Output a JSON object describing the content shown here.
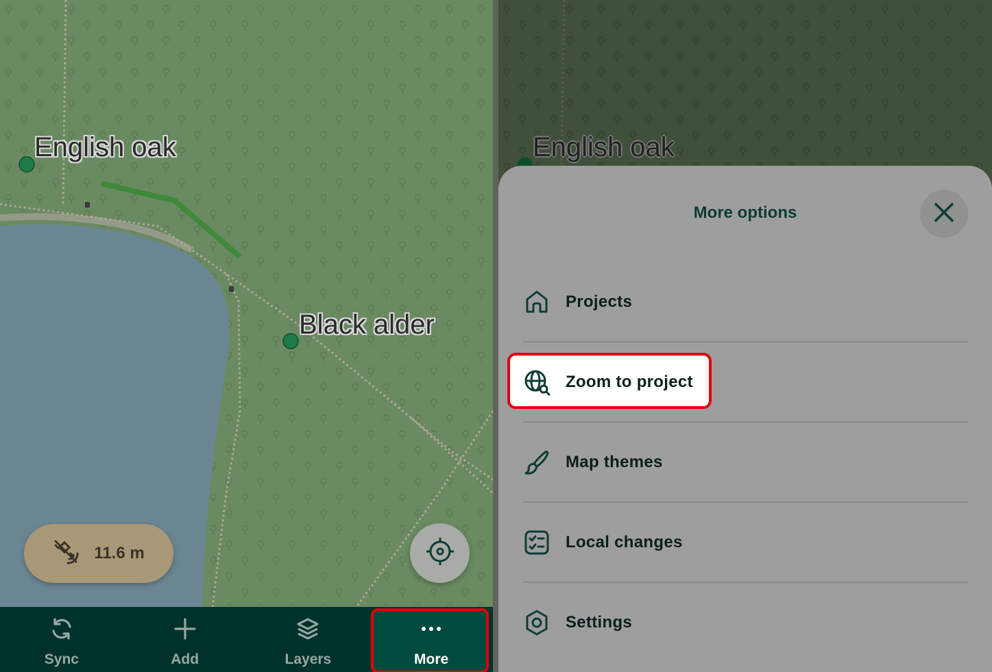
{
  "left_map": {
    "labels": {
      "english_oak": "English oak",
      "black_alder": "Black alder"
    },
    "gps_accuracy": "11.6 m"
  },
  "bottom_nav": {
    "items": [
      {
        "label": "Sync",
        "icon": "sync-icon"
      },
      {
        "label": "Add",
        "icon": "plus-icon"
      },
      {
        "label": "Layers",
        "icon": "layers-icon"
      },
      {
        "label": "More",
        "icon": "more-dots-icon",
        "active": true
      }
    ]
  },
  "right_map": {
    "labels": {
      "english_oak": "English oak"
    }
  },
  "more_sheet": {
    "title": "More options",
    "items": [
      {
        "label": "Projects",
        "icon": "home-icon"
      },
      {
        "label": "Zoom to project",
        "icon": "globe-search-icon",
        "highlighted": true
      },
      {
        "label": "Map themes",
        "icon": "brush-icon"
      },
      {
        "label": "Local changes",
        "icon": "checklist-icon"
      },
      {
        "label": "Settings",
        "icon": "settings-icon"
      }
    ]
  },
  "colors": {
    "forest": "#6a8a62",
    "water": "#6b8693",
    "nav_bg": "#00322b",
    "accent_red": "#e1000d",
    "sheet_bg": "#9e9e9e",
    "point": "#1e7a48"
  }
}
